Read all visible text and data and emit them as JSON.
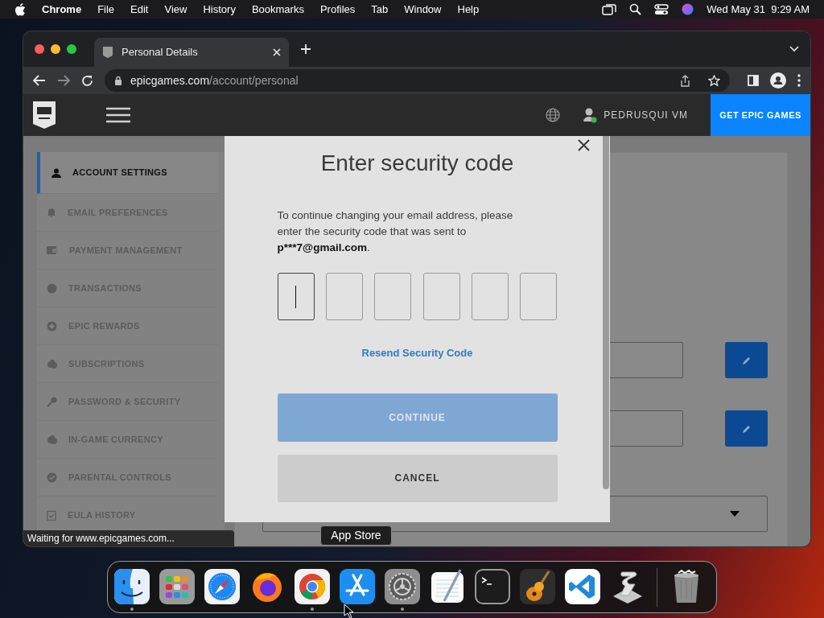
{
  "menu_bar": {
    "app": "Chrome",
    "items": [
      "File",
      "Edit",
      "View",
      "History",
      "Bookmarks",
      "Profiles",
      "Tab",
      "Window",
      "Help"
    ],
    "clock": "Wed May 31  9:29 AM"
  },
  "browser": {
    "tab_title": "Personal Details",
    "url_host": "epicgames.com",
    "url_path": "/account/personal",
    "status": "Waiting for www.epicgames.com..."
  },
  "site_header": {
    "username": "PEDRUSQUI VM",
    "cta": "GET EPIC GAMES"
  },
  "sidebar": {
    "items": [
      {
        "label": "ACCOUNT SETTINGS",
        "selected": true
      },
      {
        "label": "EMAIL PREFERENCES",
        "selected": false
      },
      {
        "label": "PAYMENT MANAGEMENT",
        "selected": false
      },
      {
        "label": "TRANSACTIONS",
        "selected": false
      },
      {
        "label": "EPIC REWARDS",
        "selected": false
      },
      {
        "label": "SUBSCRIPTIONS",
        "selected": false
      },
      {
        "label": "PASSWORD & SECURITY",
        "selected": false
      },
      {
        "label": "IN-GAME CURRENCY",
        "selected": false
      },
      {
        "label": "PARENTAL CONTROLS",
        "selected": false
      },
      {
        "label": "EULA HISTORY",
        "selected": false
      }
    ]
  },
  "modal": {
    "title": "Enter security code",
    "message": "To continue changing your email address, please enter the security code that was sent to ",
    "email": "p***7@gmail.com",
    "message_end": ".",
    "code_boxes": [
      {
        "focused": true
      },
      {
        "focused": false
      },
      {
        "focused": false
      },
      {
        "focused": false
      },
      {
        "focused": false
      },
      {
        "focused": false
      }
    ],
    "resend": "Resend Security Code",
    "continue": {
      "label": "CONTINUE",
      "disabled": true
    },
    "cancel": "CANCEL"
  },
  "dock": {
    "tooltip": "App Store",
    "apps": [
      {
        "kind": "finder",
        "running": true
      },
      {
        "kind": "launchpad",
        "running": false
      },
      {
        "kind": "safari",
        "running": false
      },
      {
        "kind": "firefox",
        "running": false
      },
      {
        "kind": "chrome",
        "running": true
      },
      {
        "kind": "appstore",
        "running": false
      },
      {
        "kind": "settings",
        "running": true
      },
      {
        "kind": "textedit",
        "running": false
      },
      {
        "kind": "terminal",
        "running": false
      },
      {
        "kind": "garageband",
        "running": false
      },
      {
        "kind": "vscode",
        "running": false
      },
      {
        "kind": "scripteditor",
        "running": false
      },
      {
        "kind": "trash",
        "running": false
      }
    ]
  }
}
